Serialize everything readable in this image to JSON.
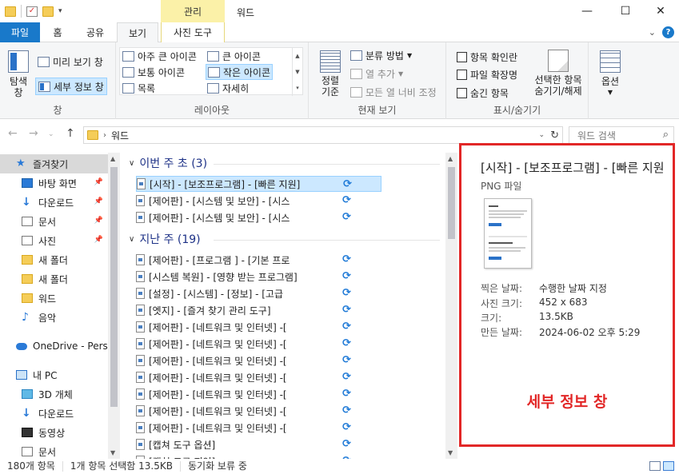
{
  "window": {
    "title": "워드",
    "context_tab": "관리",
    "minimize": "—",
    "maximize": "☐",
    "close": "✕"
  },
  "tabs": [
    {
      "label": "파일"
    },
    {
      "label": "홈"
    },
    {
      "label": "공유"
    },
    {
      "label": "보기"
    },
    {
      "label": "사진 도구"
    }
  ],
  "ribbon": {
    "pane_group": {
      "label": "창",
      "nav_pane": "탐색\n창",
      "preview_pane": "미리 보기 창",
      "details_pane": "세부 정보 창"
    },
    "layout_group": {
      "label": "레이아웃",
      "items": [
        "아주 큰 아이콘",
        "큰 아이콘",
        "보통 아이콘",
        "작은 아이콘",
        "목록",
        "자세히"
      ],
      "selected": "작은 아이콘"
    },
    "current_view_group": {
      "label": "현재 보기",
      "sort_by": "정렬\n기준",
      "group_by": "분류 방법",
      "add_columns": "열 추가",
      "fit_columns": "모든 열 너비 조정"
    },
    "show_hide_group": {
      "label": "표시/숨기기",
      "item_checkboxes": "항목 확인란",
      "file_extensions": "파일 확장명",
      "hidden_items": "숨긴 항목",
      "hide_selected": "선택한 항목\n숨기기/해제"
    },
    "options": "옵션"
  },
  "address": {
    "path": "워드",
    "search_placeholder": "워드 검색"
  },
  "nav_pane": [
    {
      "label": "즐겨찾기",
      "icon": "star-icon",
      "selected": true,
      "pinned": false,
      "indent": 0
    },
    {
      "label": "바탕 화면",
      "icon": "desktop-icon",
      "selected": false,
      "pinned": true,
      "indent": 1
    },
    {
      "label": "다운로드",
      "icon": "download-icon",
      "selected": false,
      "pinned": true,
      "indent": 1
    },
    {
      "label": "문서",
      "icon": "document-icon",
      "selected": false,
      "pinned": true,
      "indent": 1
    },
    {
      "label": "사진",
      "icon": "picture-icon",
      "selected": false,
      "pinned": true,
      "indent": 1
    },
    {
      "label": "새 폴더",
      "icon": "folder-icon",
      "selected": false,
      "pinned": false,
      "indent": 1
    },
    {
      "label": "새 폴더",
      "icon": "folder-icon",
      "selected": false,
      "pinned": false,
      "indent": 1
    },
    {
      "label": "워드",
      "icon": "folder-icon",
      "selected": false,
      "pinned": false,
      "indent": 1
    },
    {
      "label": "음악",
      "icon": "music-icon",
      "selected": false,
      "pinned": false,
      "indent": 1
    },
    {
      "label": "OneDrive - Personal",
      "icon": "cloud-icon",
      "selected": false,
      "pinned": false,
      "indent": 0
    },
    {
      "label": "내 PC",
      "icon": "pc-icon",
      "selected": false,
      "pinned": false,
      "indent": 0
    },
    {
      "label": "3D 개체",
      "icon": "cube-icon",
      "selected": false,
      "pinned": false,
      "indent": 1
    },
    {
      "label": "다운로드",
      "icon": "download-icon",
      "selected": false,
      "pinned": false,
      "indent": 1
    },
    {
      "label": "동영상",
      "icon": "video-icon",
      "selected": false,
      "pinned": false,
      "indent": 1
    },
    {
      "label": "문서",
      "icon": "document-icon",
      "selected": false,
      "pinned": false,
      "indent": 1
    }
  ],
  "groups": [
    {
      "header": "이번 주 초 (3)",
      "files": [
        {
          "name": "[시작] - [보조프로그램] - [빠른 지원]",
          "selected": true
        },
        {
          "name": "[제어판] - [시스템 및 보안] - [시스",
          "selected": false
        },
        {
          "name": "[제어판] - [시스템 및 보안] - [시스",
          "selected": false
        }
      ]
    },
    {
      "header": "지난 주 (19)",
      "files": [
        {
          "name": "[제어판] - [프로그램 ] - [기본 프로",
          "selected": false
        },
        {
          "name": "[시스템 복원] - [영향 받는 프로그램]",
          "selected": false
        },
        {
          "name": "[설정] - [시스템] - [정보] - [고급",
          "selected": false
        },
        {
          "name": "[엣지] - [즐겨 찾기 관리 도구]",
          "selected": false
        },
        {
          "name": "[제어판] - [네트워크 및 인터넷] -[",
          "selected": false
        },
        {
          "name": "[제어판] - [네트워크 및 인터넷] -[",
          "selected": false
        },
        {
          "name": "[제어판] - [네트워크 및 인터넷] -[",
          "selected": false
        },
        {
          "name": "[제어판] - [네트워크 및 인터넷] -[",
          "selected": false
        },
        {
          "name": "[제어판] - [네트워크 및 인터넷] -[",
          "selected": false
        },
        {
          "name": "[제어판] - [네트워크 및 인터넷] -[",
          "selected": false
        },
        {
          "name": "[제어판] - [네트워크 및 인터넷] -[",
          "selected": false
        },
        {
          "name": "[캡쳐 도구 옵션]",
          "selected": false
        },
        {
          "name": "[캡쳐 도구 지연]",
          "selected": false
        }
      ]
    }
  ],
  "details": {
    "title": "[시작] - [보조프로그램] - [빠른 지원]",
    "type": "PNG 파일",
    "rows": [
      {
        "key": "찍은 날짜:",
        "value": "수행한 날짜 지정"
      },
      {
        "key": "사진 크기:",
        "value": "452 x 683"
      },
      {
        "key": "크기:",
        "value": "13.5KB"
      },
      {
        "key": "만든 날짜:",
        "value": "2024-06-02 오후 5:29"
      }
    ],
    "annotation": "세부 정보 창",
    "highlight_color": "#e22727"
  },
  "status": {
    "count": "180개 항목",
    "selection": "1개 항목 선택함 13.5KB",
    "sync": "동기화 보류 중"
  }
}
